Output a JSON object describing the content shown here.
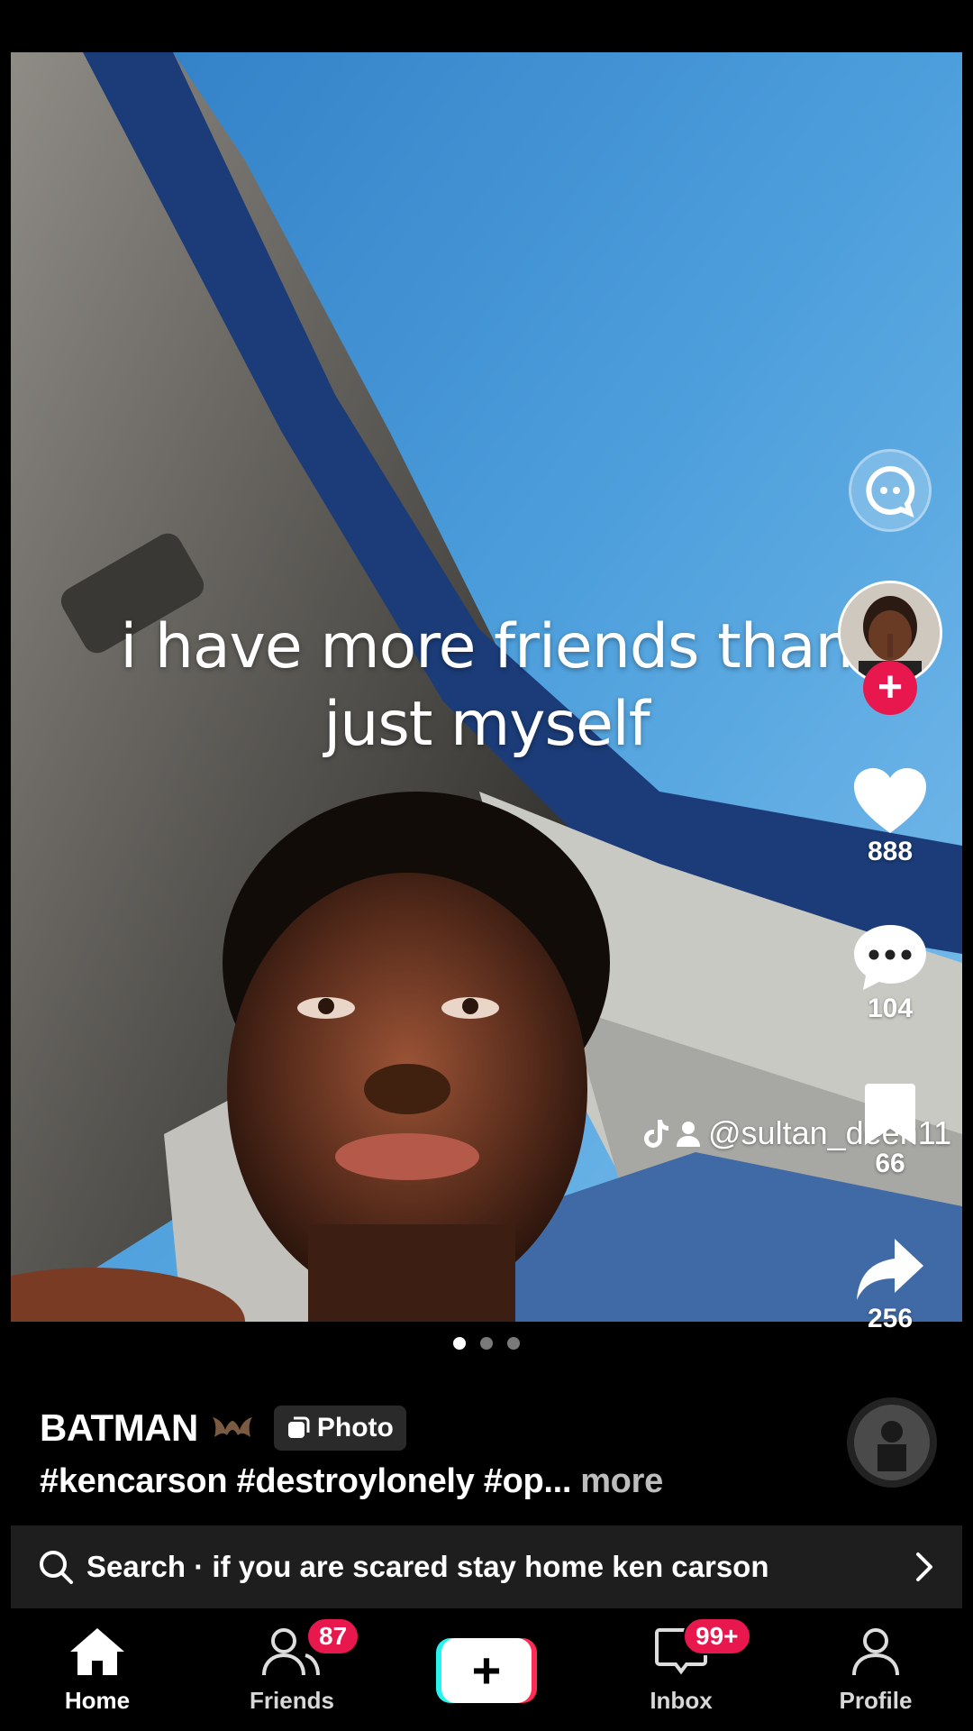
{
  "post": {
    "overlay_line1": "i have more friends than",
    "overlay_line2": "just myself",
    "watermark_handle": "@sultan_deen11",
    "page_dots": 3,
    "active_dot": 0
  },
  "actions": {
    "likes": "888",
    "comments": "104",
    "saves": "66",
    "shares": "256"
  },
  "caption": {
    "author": "BATMAN",
    "type_badge": "Photo",
    "tags": "#kencarson #destroylonely #op...",
    "more_label": "more"
  },
  "search": {
    "text": "Search · if you are scared stay home ken carson"
  },
  "nav": {
    "home": "Home",
    "friends": "Friends",
    "friends_badge": "87",
    "inbox": "Inbox",
    "inbox_badge": "99+",
    "profile": "Profile",
    "create": "+"
  },
  "colors": {
    "accent": "#e8174e",
    "cyan": "#25f4ee",
    "pink": "#fe2c55"
  }
}
